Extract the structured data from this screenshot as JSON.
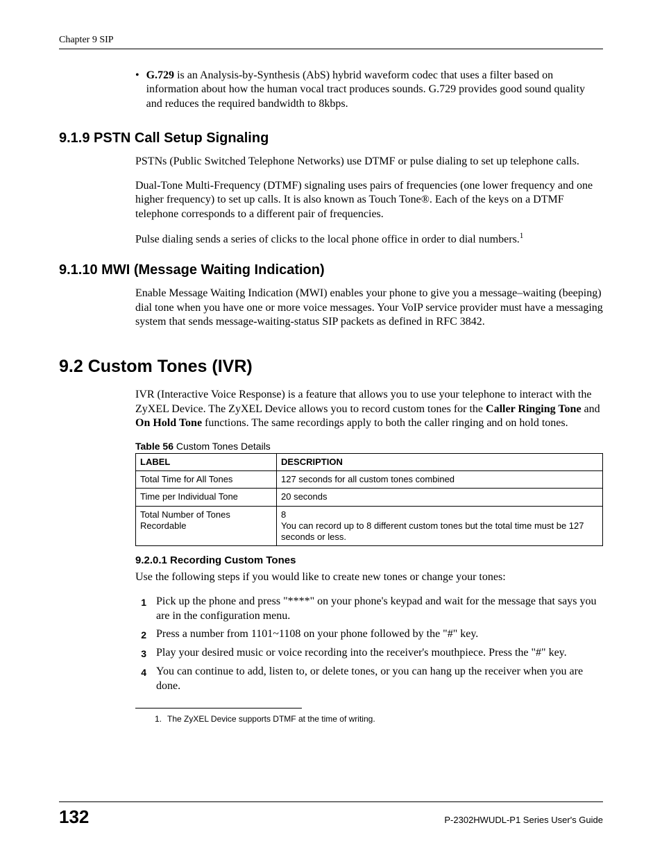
{
  "header": {
    "chapter": "Chapter 9 SIP"
  },
  "bullet": {
    "label": "G.729",
    "text": " is an Analysis-by-Synthesis (AbS) hybrid waveform codec that uses a filter based on information about how the human vocal tract produces sounds. G.729 provides good sound quality and reduces the required bandwidth to 8kbps."
  },
  "s919": {
    "title": "9.1.9  PSTN Call Setup Signaling",
    "p1": "PSTNs (Public Switched Telephone Networks) use DTMF or pulse dialing to set up telephone calls.",
    "p2": "Dual-Tone Multi-Frequency (DTMF) signaling uses pairs of frequencies (one lower frequency and one higher frequency) to set up calls. It is also known as Touch Tone®. Each of the keys on a DTMF telephone corresponds to a different pair of frequencies.",
    "p3_pre": "Pulse dialing sends a series of clicks to the local phone office in order to dial numbers.",
    "p3_sup": "1"
  },
  "s9110": {
    "title": "9.1.10  MWI (Message Waiting Indication)",
    "p1": "Enable Message Waiting Indication (MWI) enables your phone to give you a message–waiting (beeping) dial tone when you have one or more voice messages. Your VoIP service provider must have a messaging system that sends message-waiting-status SIP packets as defined in RFC 3842."
  },
  "s92": {
    "title": "9.2  Custom Tones (IVR)",
    "p1_pre": "IVR (Interactive Voice Response) is a feature that allows you to use your telephone to interact with the ZyXEL Device. The ZyXEL Device allows you to record custom tones for the ",
    "p1_b1": "Caller Ringing Tone",
    "p1_mid": " and ",
    "p1_b2": "On Hold Tone",
    "p1_post": " functions. The same recordings apply to both the caller ringing and on hold tones."
  },
  "table": {
    "caption_bold": "Table 56",
    "caption_rest": "   Custom Tones Details",
    "head_label": "LABEL",
    "head_desc": "DESCRIPTION",
    "rows": [
      {
        "label": "Total Time for All Tones",
        "desc": "127 seconds for all custom tones combined"
      },
      {
        "label": "Time per Individual Tone",
        "desc": "20 seconds"
      },
      {
        "label": "Total Number of Tones Recordable",
        "desc": "8\nYou can record up to 8 different custom tones but the total time must be 127 seconds or less."
      }
    ]
  },
  "s9201": {
    "title": "9.2.0.1  Recording Custom Tones",
    "intro": "Use the following steps if you would like to create new tones or change your tones:",
    "steps": [
      "Pick up the phone and press \"****\" on your phone's keypad and wait for the message that says you are in the configuration menu.",
      "Press a number from 1101~1108 on your phone followed by the \"#\" key.",
      "Play your desired music or voice recording into the receiver's mouthpiece. Press the \"#\" key.",
      "You can continue to add, listen to, or delete tones, or you can hang up the receiver when you are done."
    ]
  },
  "footnote": {
    "num": "1.",
    "text": "The ZyXEL Device supports DTMF at the time of writing."
  },
  "footer": {
    "page": "132",
    "guide": "P-2302HWUDL-P1 Series User's Guide"
  }
}
